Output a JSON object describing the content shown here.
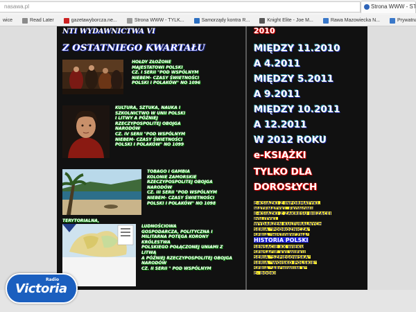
{
  "browser": {
    "address": "nasawa.pl",
    "tab_title": "Strona WWW - STRO",
    "bookmarks": [
      {
        "label": "wice",
        "icon": "none",
        "color": "#ffffff"
      },
      {
        "label": "Read Later",
        "icon": "document-icon",
        "color": "#8a8a8a"
      },
      {
        "label": "gazetawyborcza.ne...",
        "icon": "newspaper-icon",
        "color": "#c22"
      },
      {
        "label": "Strona WWW - TYLK...",
        "icon": "globe-icon",
        "color": "#999"
      },
      {
        "label": "Samorządy kontra R...",
        "icon": "page-icon",
        "color": "#2c6fc1"
      },
      {
        "label": "Knight Elite - Joe M...",
        "icon": "page-icon",
        "color": "#555"
      },
      {
        "label": "Rawa Mazowiecka N...",
        "icon": "page-icon",
        "color": "#3a78c9"
      },
      {
        "label": "Prywatna kamienica...",
        "icon": "page-icon",
        "color": "#3a78c9"
      }
    ]
  },
  "left": {
    "top_heading": "NTI WYDAWNICTWA VI",
    "section_heading": "Z OSTATNIEGO KWARTAŁU",
    "items": [
      {
        "lines": [
          "HOŁDY ZŁOŻONE",
          "MAJESTATOWI POLSKI",
          "CZ. I SERII \"POD WSPÓLNYM",
          "NIEBEM- CZASY ŚWIETNOŚCI",
          "POLSKI I POLAKÓW\" No 1096"
        ]
      },
      {
        "lines": [
          "KULTURA, SZTUKA, NAUKA I",
          "SZKOLNICTWO W UNII POLSKI",
          "I LITWY A PÓŹNIEJ",
          "RZECZYPOSPOLITEJ OBOJGA",
          "NARODÓW",
          "CZ. IV SERII \"POD WSPÓLNYM",
          "NIEBEM- CZASY ŚWIETNOŚCI",
          "POLSKI I POLAKÓW\" No 1099"
        ]
      },
      {
        "lines": [
          "TOBAGO I GAMBIA",
          "KOLONIE ZAMORSKIE",
          "RZECZYPOSPOLITEJ OBOJGA",
          "NARODÓW",
          "CZ. III SERII \"POD WSPÓLNYM",
          "NIEBEM- CZASY ŚWIETNOŚCI",
          "POLSKI I POLAKÓW\" No 1098"
        ]
      },
      {
        "lines": [
          "LUDNOŚCIOWA",
          "GOSPODARCZA, POLITYCZNA I",
          "MILITARNA POTĘGA KORONY",
          "KRÓLESTWA",
          "POLSKIEGO POŁĄCZONEJ UNIAMI Z",
          "LITWĄ",
          "A PÓŹNIEJ RZECZYPOSPOLITEJ OBOJGA",
          "NARODÓW",
          "CZ. II SERII \" POD WSPÓLNYM"
        ]
      }
    ],
    "map_caption": "TERYTORIALNA,"
  },
  "right": {
    "partial_top": "2010",
    "lines": [
      "MIĘDZY 11.2010",
      "A 4.2011",
      "MIĘDZY 5.2011",
      "A 9.2011",
      "MIĘDZY 10.2011",
      "A 12.2011",
      "W 2012 ROKU"
    ],
    "red_lines": [
      "e-KSIĄŻKI",
      "TYLKO DLA",
      "DOROSŁYCH"
    ],
    "list": [
      "e-KSIĄŻKI Z INFORMATYKI,",
      "MATEMATYKI, EKONOMII",
      "e-KSIĄŻKI Z ZAKRESU BIEŻĄCEJ",
      "POLITYKI,",
      "WYDARZEŃ KULTURALNYCH",
      "SERIA \"PODRÓŻNICZA\"",
      "SERIA \"HISTORYCZNA\"",
      "HISTORIA POLSKI",
      "SENSACJE XX WIEKU",
      "SENSACJE XXI WIEKU",
      "SERIA \"SZPIEGOWSKA\"",
      "SERIA \"WOJSKO POLSKIE\"",
      "SERIA \"ARCHIWUM X\"",
      "e- BOOKI"
    ],
    "highlight_index": 7
  },
  "logo": {
    "name": "Victoria",
    "radio": "Radio"
  },
  "colors": {
    "panel": "#111111",
    "green_glow": "#21e021",
    "yellow": "#ffef2a",
    "blue_highlight": "#1b1fd8",
    "red_glow": "#ff1010",
    "logo_blue": "#1b5fbf"
  }
}
